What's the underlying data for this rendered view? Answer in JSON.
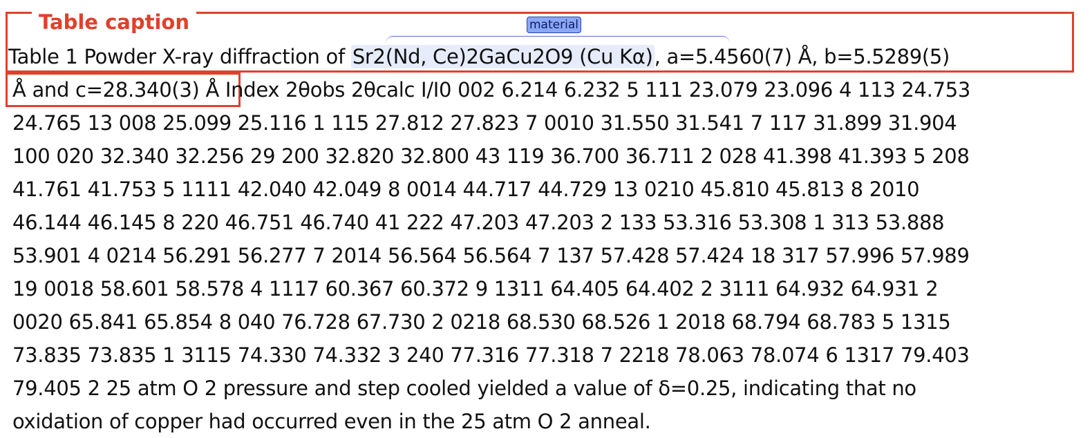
{
  "annotations": {
    "caption_label": "Table caption",
    "entity_tag": "material"
  },
  "colors": {
    "caption_box": "#e0402a",
    "entity_tag_bg": "#8aa8f4",
    "entity_highlight": "#e6ecfb"
  },
  "document": {
    "line1": {
      "before": "Table 1 Powder X-ray diffraction of ",
      "entity": "Sr2(Nd, Ce)2GaCu2O9 (Cu Kα)",
      "after": ", a=5.4560(7) Å, b=5.5289(5)"
    },
    "line2": "Å and c=28.340(3) Å Index 2θobs 2θcalc I/I0 002 6.214 6.232 5 111 23.079 23.096 4 113 24.753",
    "line3": "24.765 13 008 25.099 25.116 1 115 27.812 27.823 7 0010 31.550 31.541 7 117 31.899 31.904",
    "line4": "100 020 32.340 32.256 29 200 32.820 32.800 43 119 36.700 36.711 2 028 41.398 41.393 5 208",
    "line5": "41.761 41.753 5 1111 42.040 42.049 8 0014 44.717 44.729 13 0210 45.810 45.813 8 2010",
    "line6": "46.144 46.145 8 220 46.751 46.740 41 222 47.203 47.203 2 133 53.316 53.308 1 313 53.888",
    "line7": "53.901 4 0214 56.291 56.277 7 2014 56.564 56.564 7 137 57.428 57.424 18 317 57.996 57.989",
    "line8": "19 0018 58.601 58.578 4 1117 60.367 60.372 9 1311 64.405 64.402 2 3111 64.932 64.931 2",
    "line9": "0020 65.841 65.854 8 040 76.728 67.730 2 0218 68.530 68.526 1 2018 68.794 68.783 5 1315",
    "line10": "73.835 73.835 1 3115 74.330 74.332 3 240 77.316 77.318 7 2218 78.063 78.074 6 1317 79.403",
    "line11": "79.405 2 25 atm O 2 pressure and step cooled yielded a value of δ=0.25, indicating that no",
    "line12": "oxidation of copper had occurred even in the 25 atm O 2 anneal."
  }
}
